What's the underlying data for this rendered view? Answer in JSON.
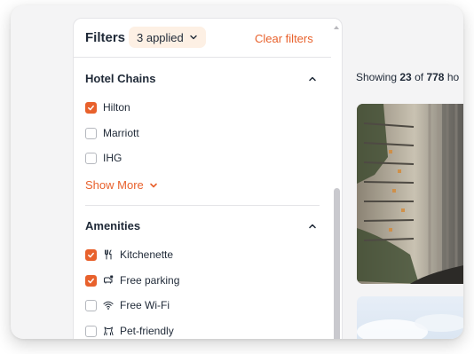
{
  "filters": {
    "title": "Filters",
    "applied_label": "3 applied",
    "clear_label": "Clear filters"
  },
  "hotel_chains": {
    "title": "Hotel Chains",
    "options": [
      {
        "label": "Hilton",
        "checked": true
      },
      {
        "label": "Marriott",
        "checked": false
      },
      {
        "label": "IHG",
        "checked": false
      }
    ],
    "show_more_label": "Show More"
  },
  "amenities": {
    "title": "Amenities",
    "options": [
      {
        "label": "Kitchenette",
        "checked": true,
        "icon": "utensils-icon"
      },
      {
        "label": "Free parking",
        "checked": true,
        "icon": "parking-icon"
      },
      {
        "label": "Free Wi-Fi",
        "checked": false,
        "icon": "wifi-icon"
      },
      {
        "label": "Pet-friendly",
        "checked": false,
        "icon": "pet-icon"
      }
    ]
  },
  "results": {
    "prefix": "Showing",
    "shown": "23",
    "middle": "of",
    "total": "778",
    "suffix": "ho"
  },
  "colors": {
    "accent": "#e8612c",
    "pill_bg": "#fdf0e4",
    "text": "#1f2937",
    "border": "#e4e4e7"
  }
}
